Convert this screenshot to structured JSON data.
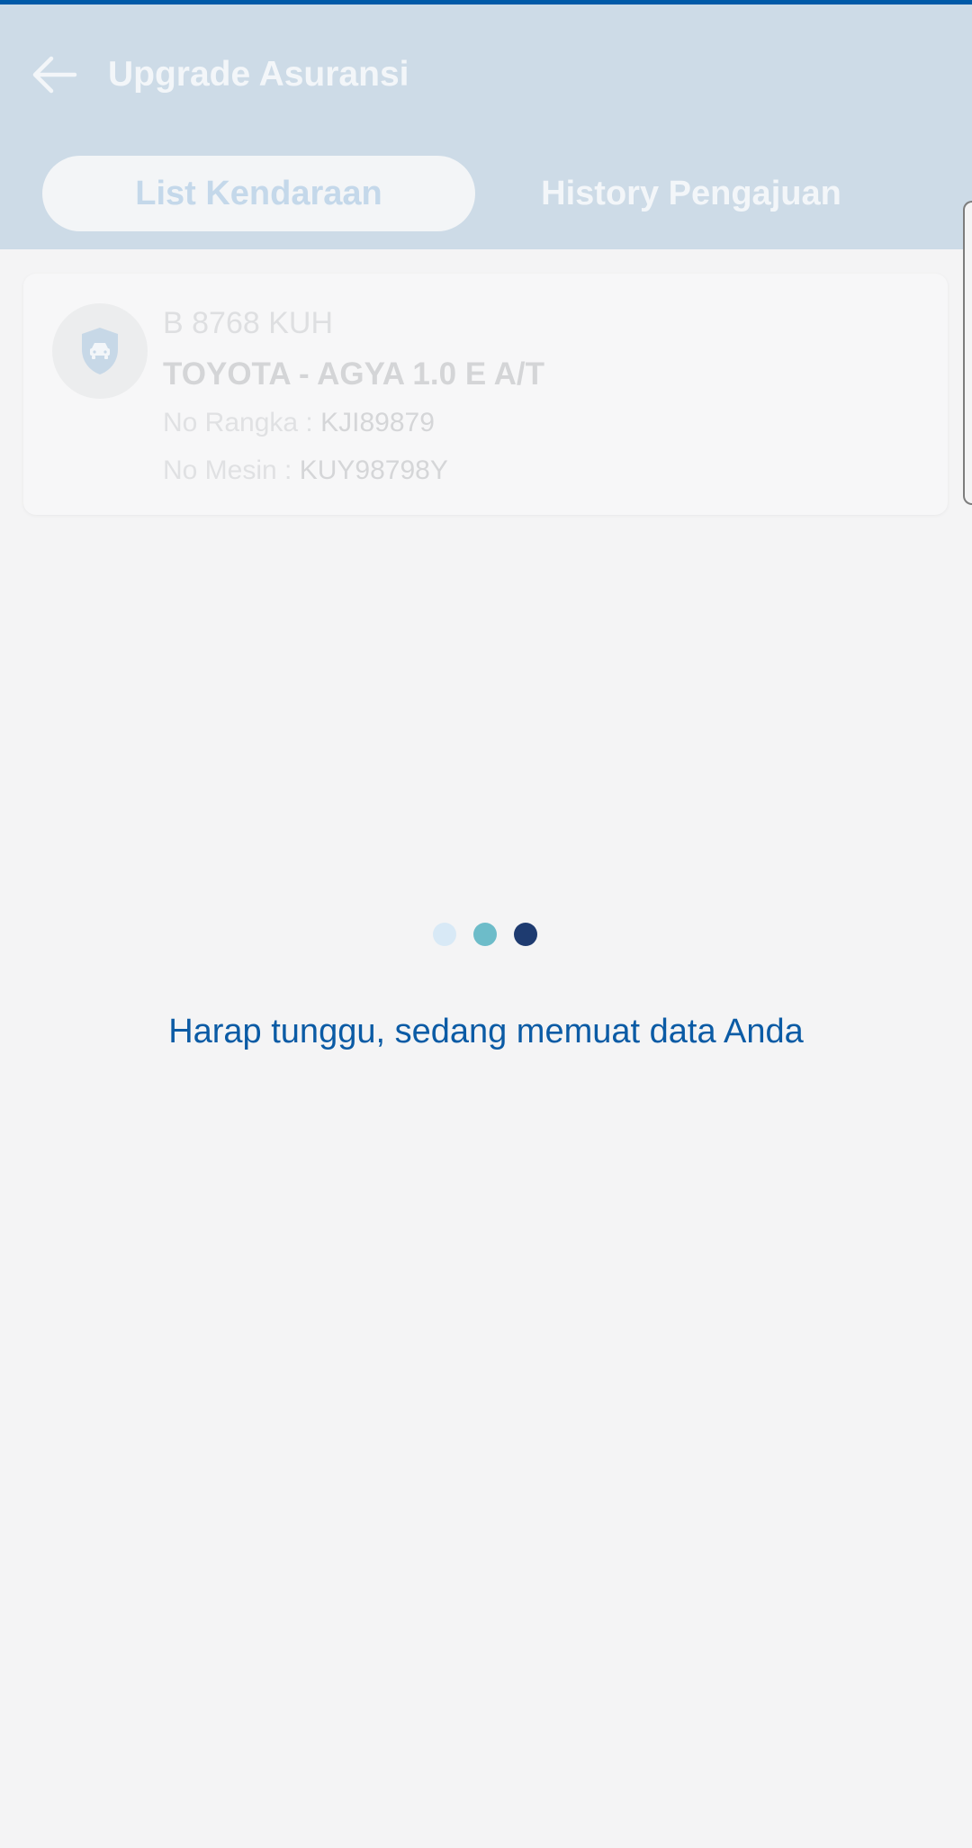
{
  "app_bar": {
    "title": "Upgrade Asuransi",
    "back_icon": "arrow-left-icon"
  },
  "tabs": [
    {
      "label": "List Kendaraan",
      "active": true
    },
    {
      "label": "History Pengajuan",
      "active": false
    }
  ],
  "vehicle": {
    "icon": "shield-car-icon",
    "plate": "B 8768 KUH",
    "model": "TOYOTA - AGYA 1.0 E A/T",
    "frame_label": "No Rangka :",
    "frame_value": "KJI89879",
    "engine_label": "No Mesin :",
    "engine_value": "KUY98798Y"
  },
  "loading": {
    "message": "Harap tunggu, sedang memuat data Anda",
    "dot_colors": [
      "#d8e9f6",
      "#6dbcc9",
      "#1e3b70"
    ]
  },
  "colors": {
    "accent": "#005aa8",
    "header_bg": "#cddbe7",
    "background": "#f4f4f5"
  }
}
